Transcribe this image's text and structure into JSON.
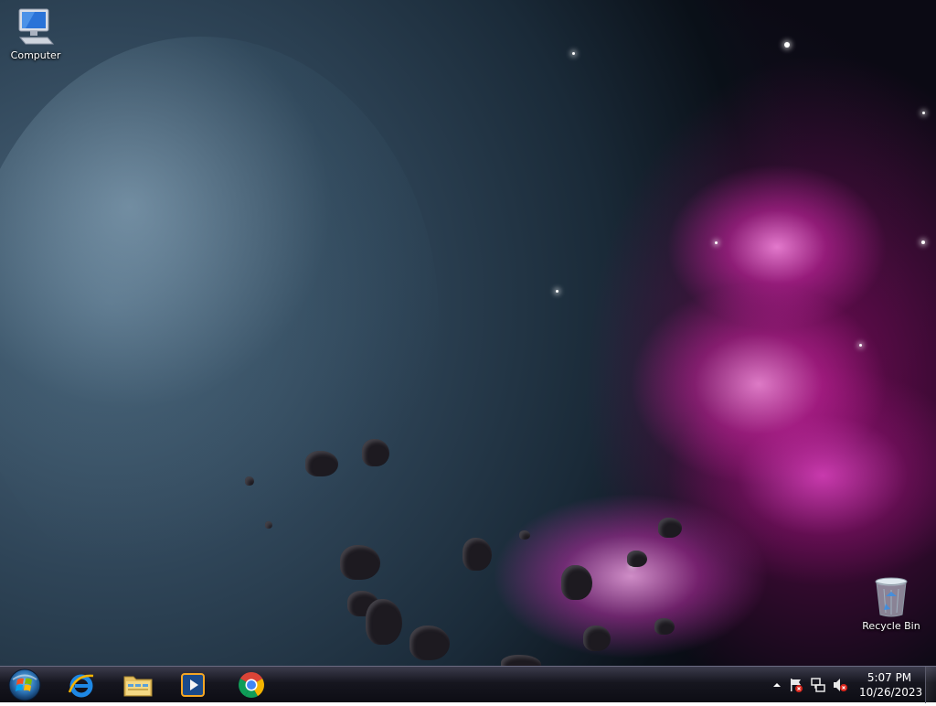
{
  "desktop": {
    "icons": [
      {
        "label": "Computer",
        "icon": "computer-icon"
      },
      {
        "label": "Recycle Bin",
        "icon": "recycle-bin-icon"
      }
    ]
  },
  "taskbar": {
    "start": {
      "icon": "windows-start-orb-icon"
    },
    "pinned": [
      {
        "app": "Internet Explorer",
        "icon": "internet-explorer-icon"
      },
      {
        "app": "Windows Explorer",
        "icon": "file-explorer-icon"
      },
      {
        "app": "Windows Media Player",
        "icon": "media-player-icon"
      },
      {
        "app": "Google Chrome",
        "icon": "chrome-icon"
      }
    ],
    "tray": {
      "icons": [
        "show-hidden-icons-icon",
        "action-center-flag-icon",
        "network-icon",
        "volume-muted-icon"
      ],
      "time": "5:07 PM",
      "date": "10/26/2023"
    }
  },
  "colors": {
    "nebula": "#d23cb4",
    "taskbar": "#16161f"
  }
}
